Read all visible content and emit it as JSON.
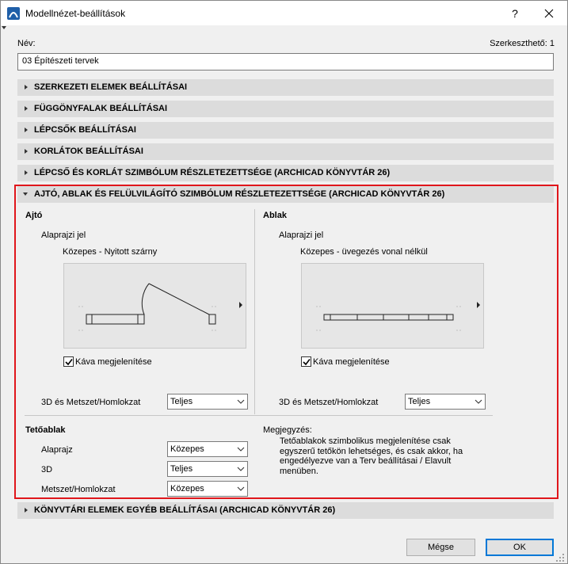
{
  "window": {
    "title": "Modellnézet-beállítások",
    "help_label": "?",
    "close_icon": "close-icon"
  },
  "name_field": {
    "label": "Név:",
    "value": "03 Építészeti tervek",
    "editable_label": "Szerkeszthető: 1"
  },
  "sections": {
    "s1": "SZERKEZETI ELEMEK BEÁLLÍTÁSAI",
    "s2": "FÜGGÖNYFALAK BEÁLLÍTÁSAI",
    "s3": "LÉPCSŐK BEÁLLÍTÁSAI",
    "s4": "KORLÁTOK BEÁLLÍTÁSAI",
    "s5": "LÉPCSŐ ÉS KORLÁT SZIMBÓLUM RÉSZLETEZETTSÉGE (ARCHICAD KÖNYVTÁR 26)",
    "s6": "AJTÓ, ABLAK ÉS FELÜLVILÁGÍTÓ SZIMBÓLUM RÉSZLETEZETTSÉGE (ARCHICAD KÖNYVTÁR 26)",
    "s7": "KÖNYVTÁRI ELEMEK EGYÉB BEÁLLÍTÁSAI (ARCHICAD KÖNYVTÁR 26)"
  },
  "door": {
    "heading": "Ajtó",
    "floor_plan_label": "Alaprajzi jel",
    "symbol_label": "Közepes - Nyitott szárny",
    "reveal_checkbox": {
      "label": "Káva megjelenítése",
      "checked": true
    },
    "section_label": "3D és Metszet/Homlokzat",
    "section_value": "Teljes"
  },
  "window_sym": {
    "heading": "Ablak",
    "floor_plan_label": "Alaprajzi jel",
    "symbol_label": "Közepes - üvegezés vonal nélkül",
    "reveal_checkbox": {
      "label": "Káva megjelenítése",
      "checked": true
    },
    "section_label": "3D és Metszet/Homlokzat",
    "section_value": "Teljes"
  },
  "skylight": {
    "heading": "Tetőablak",
    "rows": [
      {
        "label": "Alaprajz",
        "value": "Közepes"
      },
      {
        "label": "3D",
        "value": "Teljes"
      },
      {
        "label": "Metszet/Homlokzat",
        "value": "Közepes"
      }
    ]
  },
  "note": {
    "heading": "Megjegyzés:",
    "text": "Tetőablakok szimbolikus megjelenítése csak egyszerű tetőkön lehetséges, és csak akkor, ha engedélyezve van a Terv beállításai / Elavult menüben."
  },
  "buttons": {
    "cancel": "Mégse",
    "ok": "OK"
  },
  "colors": {
    "highlight_border": "#e0161b",
    "section_bar": "#dcdcdc",
    "ok_border": "#0078d7",
    "app_icon": "#1f5fa8"
  }
}
